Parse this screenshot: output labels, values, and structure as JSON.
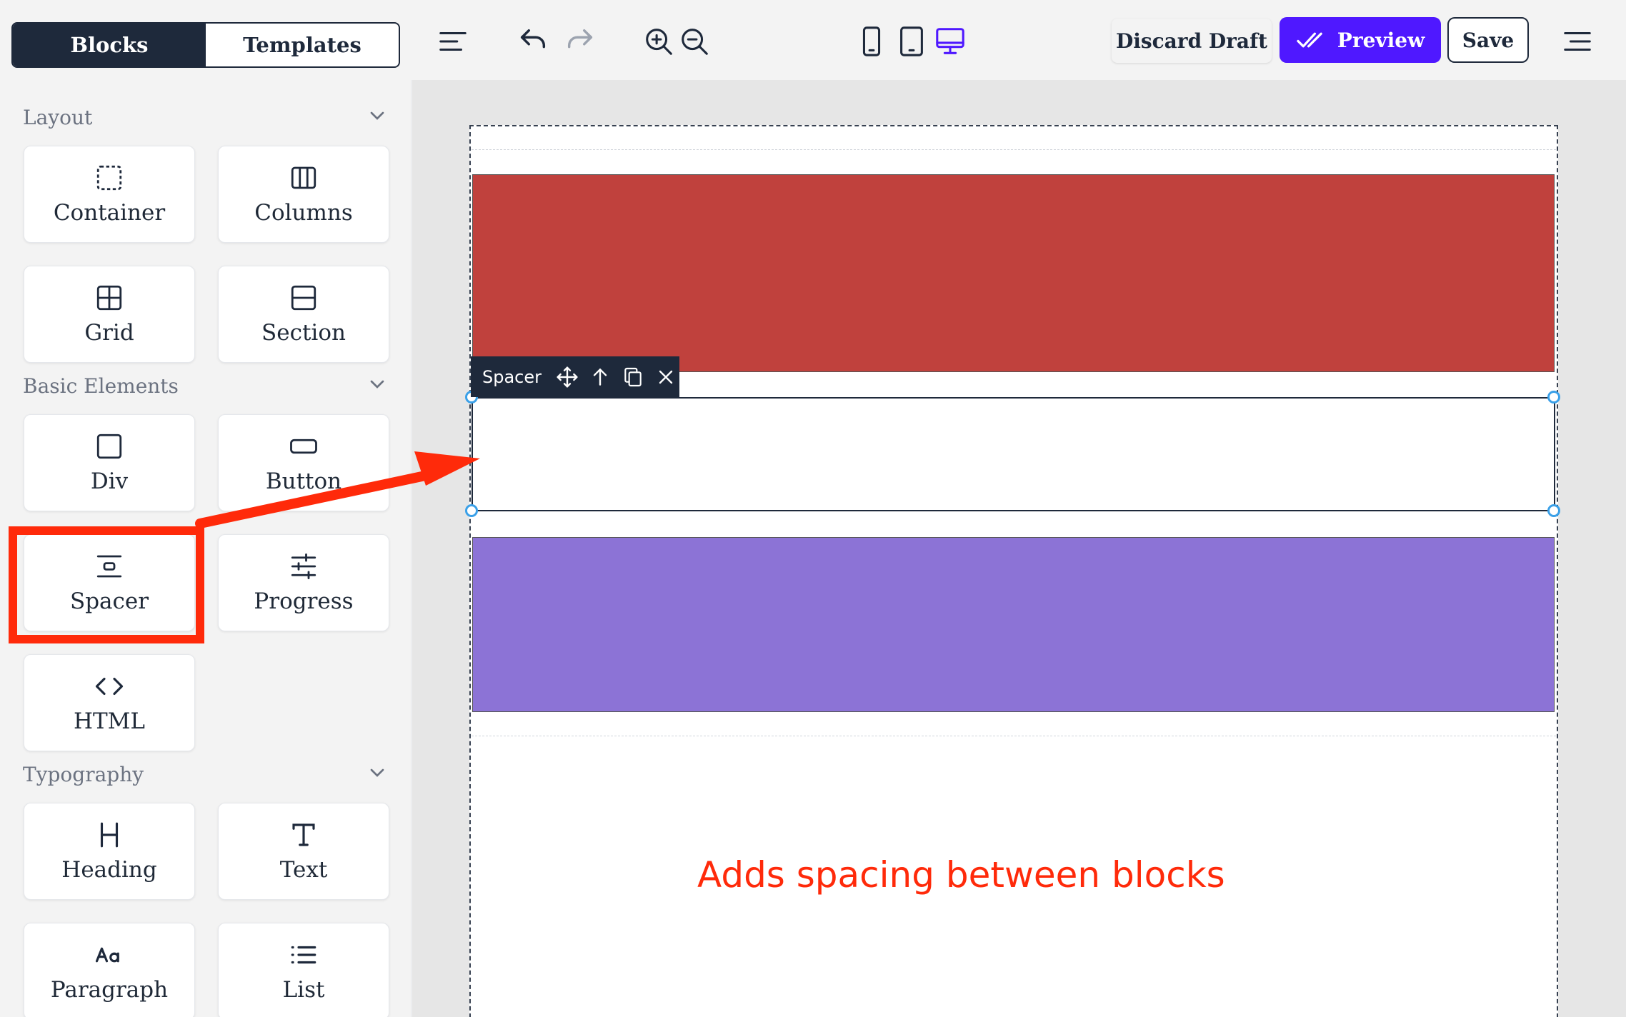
{
  "toolbar": {
    "tabs": [
      {
        "label": "Blocks",
        "active": true
      },
      {
        "label": "Templates",
        "active": false
      }
    ],
    "discard_label": "Discard Draft",
    "preview_label": "Preview",
    "save_label": "Save",
    "active_device": "desktop",
    "accent_color": "#4f18ff"
  },
  "sidebar": {
    "sections": [
      {
        "title": "Layout",
        "blocks": [
          {
            "label": "Container",
            "icon": "container-icon"
          },
          {
            "label": "Columns",
            "icon": "columns-icon"
          },
          {
            "label": "Grid",
            "icon": "grid-icon"
          },
          {
            "label": "Section",
            "icon": "section-icon"
          }
        ]
      },
      {
        "title": "Basic Elements",
        "blocks": [
          {
            "label": "Div",
            "icon": "div-icon"
          },
          {
            "label": "Button",
            "icon": "button-icon"
          },
          {
            "label": "Spacer",
            "icon": "spacer-icon"
          },
          {
            "label": "Progress",
            "icon": "sliders-icon"
          },
          {
            "label": "HTML",
            "icon": "code-icon"
          }
        ]
      },
      {
        "title": "Typography",
        "blocks": [
          {
            "label": "Heading",
            "icon": "heading-icon"
          },
          {
            "label": "Text",
            "icon": "text-icon"
          },
          {
            "label": "Paragraph",
            "icon": "paragraph-icon"
          },
          {
            "label": "List",
            "icon": "list-icon"
          }
        ]
      }
    ]
  },
  "canvas": {
    "selected_block_label": "Spacer",
    "colors": {
      "red_block": "#c0413d",
      "purple_block": "#8c73d6"
    }
  },
  "annotation": {
    "text": "Adds spacing between blocks",
    "color": "#ff2a0a"
  }
}
